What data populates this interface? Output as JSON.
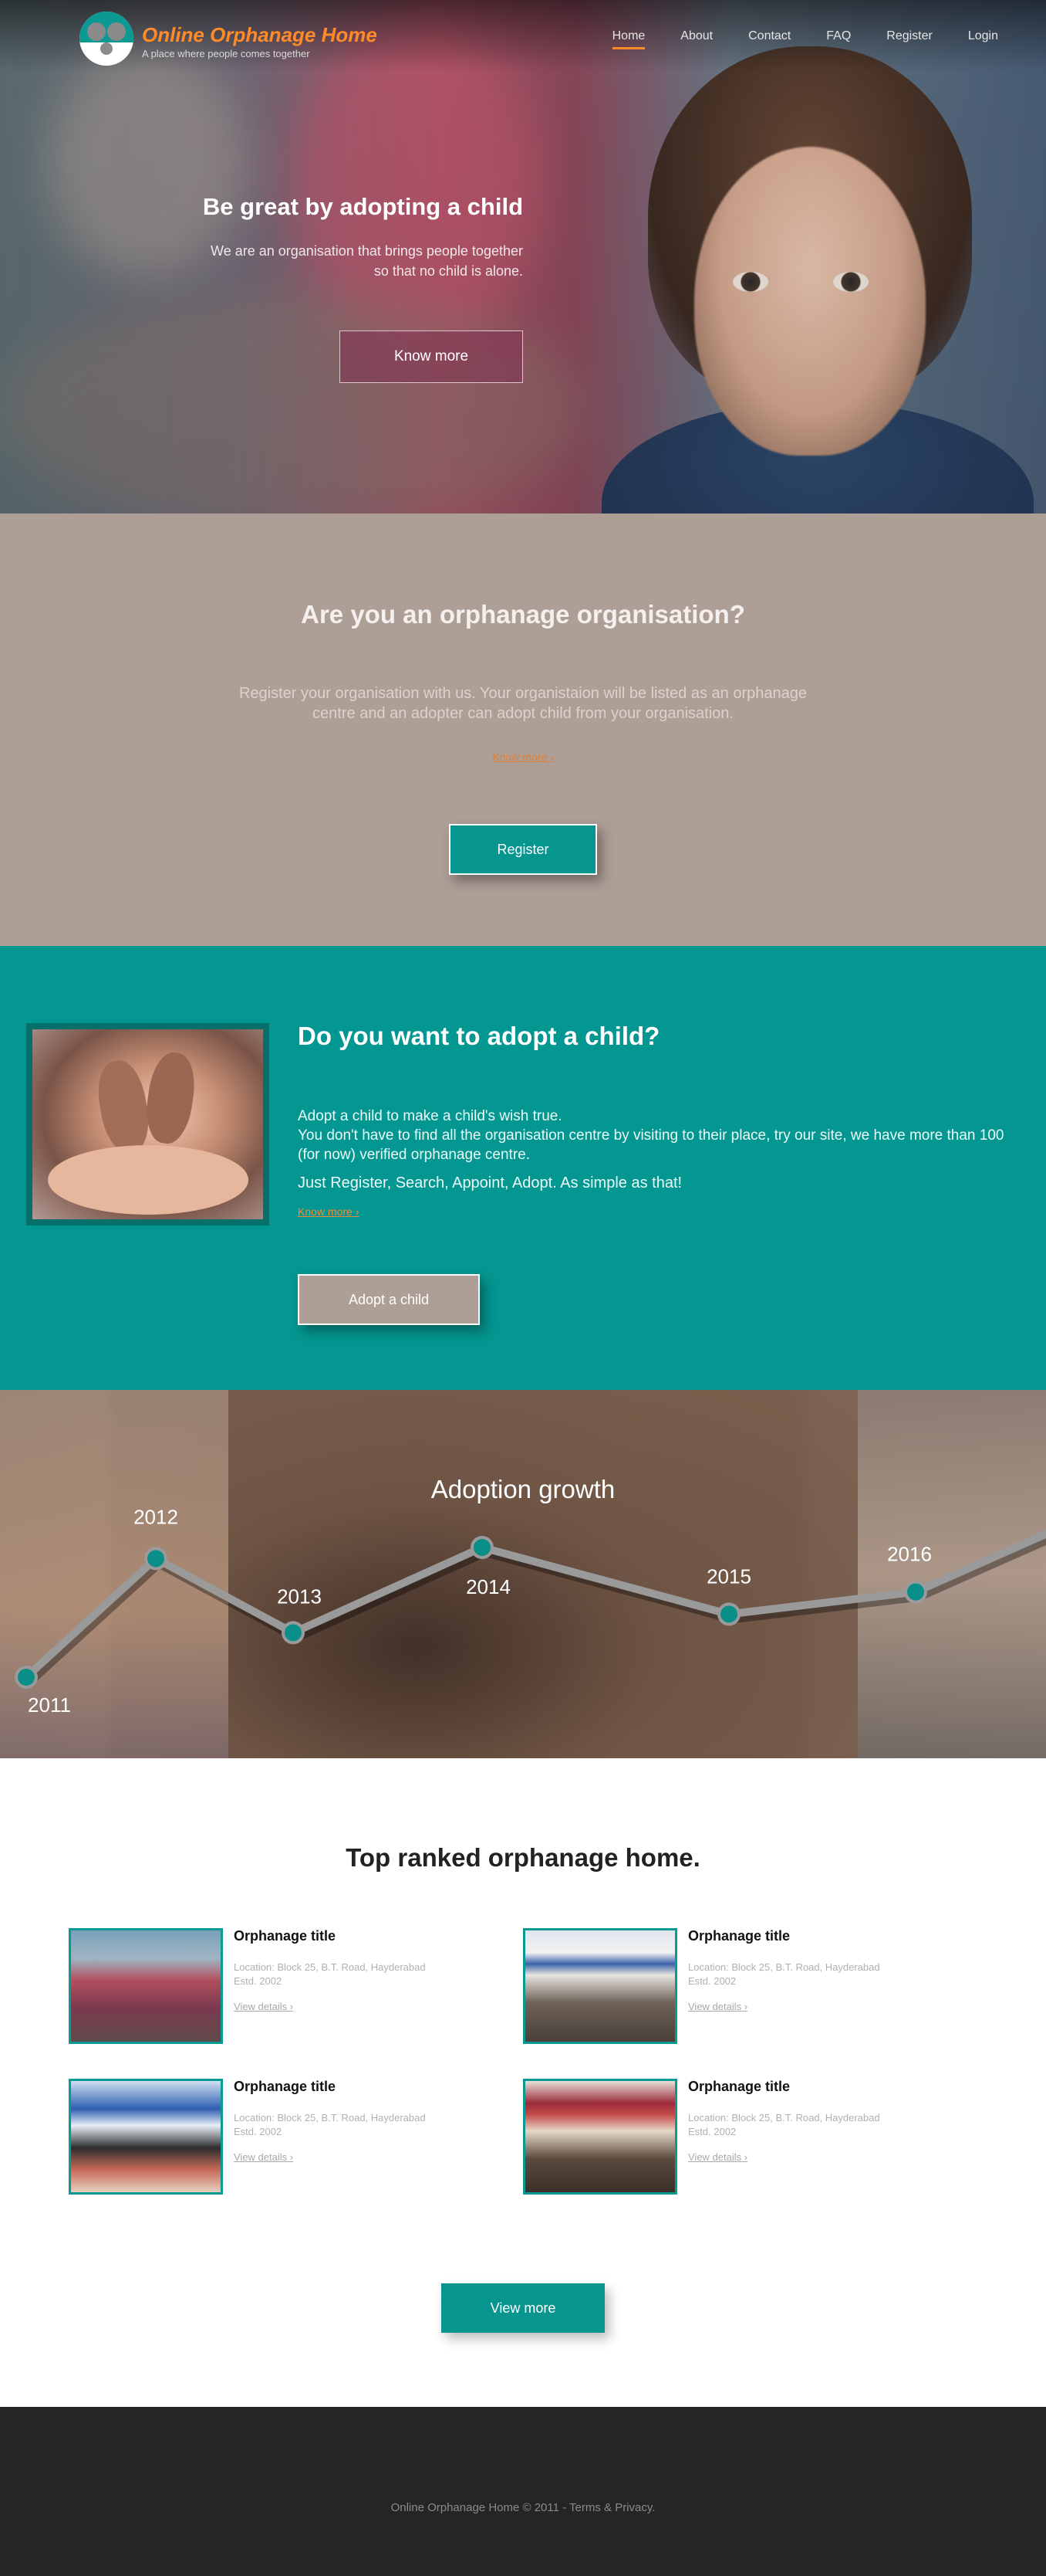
{
  "brand": {
    "title": "Online Orphanage Home",
    "tagline": "A place where people comes together"
  },
  "nav": [
    {
      "label": "Home",
      "active": true
    },
    {
      "label": "About"
    },
    {
      "label": "Contact"
    },
    {
      "label": "FAQ"
    },
    {
      "label": "Register"
    },
    {
      "label": "Login"
    }
  ],
  "hero": {
    "title": "Be great by adopting a child",
    "subtitle_line1": "We are an organisation that brings people together",
    "subtitle_line2": "so that no child is alone.",
    "button": "Know more"
  },
  "org": {
    "title": "Are you an orphanage organisation?",
    "text_line1": "Register your organisation with us. Your organistaion will be listed as an orphanage",
    "text_line2": "centre and an adopter can adopt child from your organisation.",
    "link": "Know more",
    "link_arrow": "›",
    "button": "Register"
  },
  "adopt": {
    "title": "Do you want to adopt a child?",
    "line1": "Adopt a child to make a child's wish true.",
    "line2": "You don't have to find all the organisation centre by visiting to their place, try our site, we have more than 100 (for now) verified orphanage centre.",
    "line3": "Just Register, Search, Appoint, Adopt. As simple as that!",
    "link": "Know more",
    "link_arrow": "›",
    "button": "Adopt a child"
  },
  "growth": {
    "title": "Adoption growth"
  },
  "chart_data": {
    "type": "line",
    "title": "Adoption growth",
    "x": [
      "2011",
      "2012",
      "2013",
      "2014",
      "2015",
      "2016"
    ],
    "series": [
      {
        "values": [
          1.0,
          4.2,
          2.2,
          4.5,
          2.7,
          3.3
        ]
      }
    ],
    "ylim": [
      0,
      5
    ],
    "grid": false,
    "color": "#0a8f88"
  },
  "ranked": {
    "title": "Top ranked orphanage home.",
    "cards": [
      {
        "title": "Orphanage title",
        "location": "Location: Block 25, B.T. Road, Hayderabad",
        "estd": "Estd. 2002",
        "link": "View details",
        "arrow": "›"
      },
      {
        "title": "Orphanage title",
        "location": "Location: Block 25, B.T. Road, Hayderabad",
        "estd": "Estd. 2002",
        "link": "View details",
        "arrow": "›"
      },
      {
        "title": "Orphanage title",
        "location": "Location: Block 25, B.T. Road, Hayderabad",
        "estd": "Estd. 2002",
        "link": "View details",
        "arrow": "›"
      },
      {
        "title": "Orphanage title",
        "location": "Location: Block 25, B.T. Road, Hayderabad",
        "estd": "Estd. 2002",
        "link": "View details",
        "arrow": "›"
      }
    ],
    "button": "View more"
  },
  "footer": {
    "text": "Online Orphanage Home © 2011 - Terms & Privacy."
  },
  "colors": {
    "accent": "#ff8a2a",
    "teal": "#06968f",
    "taupe": "#ad9e96",
    "footer": "#252525"
  }
}
